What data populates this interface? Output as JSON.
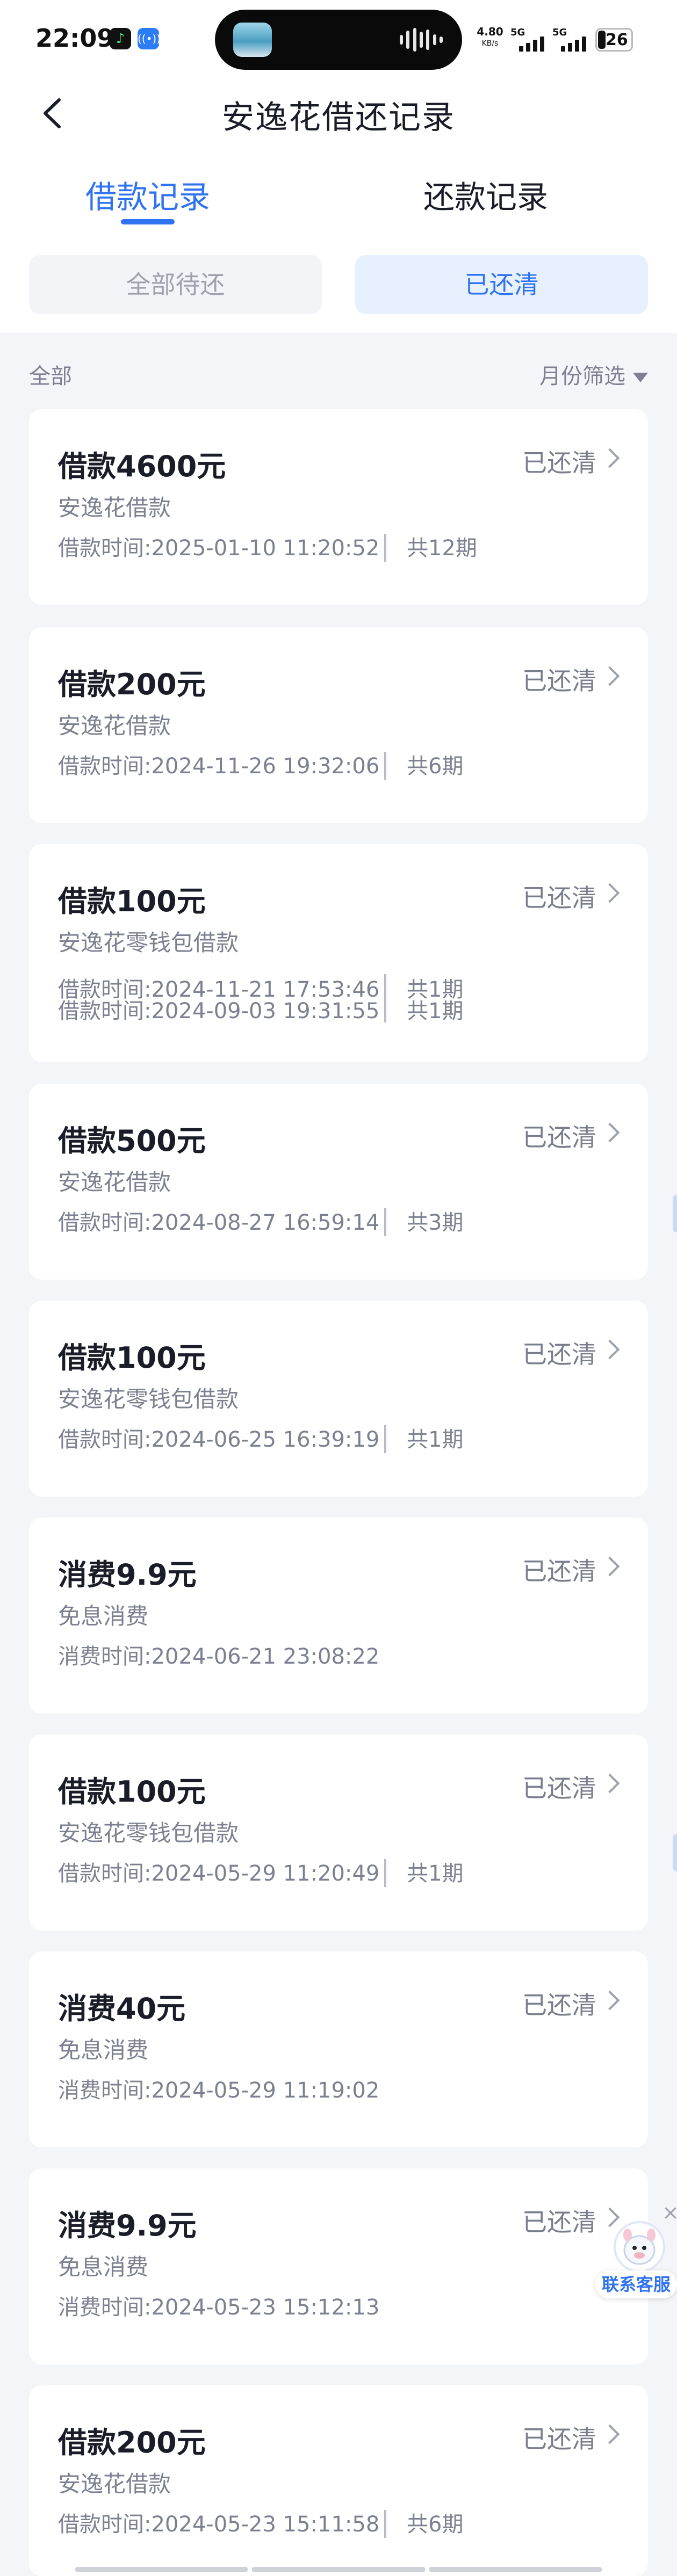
{
  "status_bar": {
    "time": "22:09",
    "net_speed": "4.80",
    "net_unit": "KB/s",
    "sim1": "5G",
    "sim2": "5G",
    "battery": "26",
    "app_icons": [
      "music-app-icon",
      "nfc-app-icon"
    ]
  },
  "header": {
    "title": "安逸花借还记录",
    "back_icon": "chevron-left-icon"
  },
  "tabs": [
    {
      "label": "借款记录",
      "active": true
    },
    {
      "label": "还款记录",
      "active": false
    }
  ],
  "filters": [
    {
      "label": "全部待还",
      "selected": false
    },
    {
      "label": "已还清",
      "selected": true
    }
  ],
  "list_header": {
    "left": "全部",
    "right": "月份筛选"
  },
  "records": [
    {
      "title": "借款4600元",
      "status": "已还清",
      "subtitle": "安逸花借款",
      "times": [
        "借款时间:2025-01-10 11:20:52"
      ],
      "periods": [
        "共12期"
      ]
    },
    {
      "title": "借款200元",
      "status": "已还清",
      "subtitle": "安逸花借款",
      "times": [
        "借款时间:2024-11-26 19:32:06"
      ],
      "periods": [
        "共6期"
      ]
    },
    {
      "title": "借款100元",
      "status": "已还清",
      "subtitle": "安逸花零钱包借款",
      "times": [
        "借款时间:2024-11-21 17:53:46",
        "借款时间:2024-09-03 19:31:55"
      ],
      "periods": [
        "共1期",
        "共1期"
      ]
    },
    {
      "title": "借款500元",
      "status": "已还清",
      "subtitle": "安逸花借款",
      "times": [
        "借款时间:2024-08-27 16:59:14"
      ],
      "periods": [
        "共3期"
      ]
    },
    {
      "title": "借款100元",
      "status": "已还清",
      "subtitle": "安逸花零钱包借款",
      "times": [
        "借款时间:2024-06-25 16:39:19"
      ],
      "periods": [
        "共1期"
      ]
    },
    {
      "title": "消费9.9元",
      "status": "已还清",
      "subtitle": "免息消费",
      "times": [
        "消费时间:2024-06-21 23:08:22"
      ],
      "periods": []
    },
    {
      "title": "借款100元",
      "status": "已还清",
      "subtitle": "安逸花零钱包借款",
      "times": [
        "借款时间:2024-05-29 11:20:49"
      ],
      "periods": [
        "共1期"
      ]
    },
    {
      "title": "消费40元",
      "status": "已还清",
      "subtitle": "免息消费",
      "times": [
        "消费时间:2024-05-29 11:19:02"
      ],
      "periods": []
    },
    {
      "title": "消费9.9元",
      "status": "已还清",
      "subtitle": "免息消费",
      "times": [
        "消费时间:2024-05-23 15:12:13"
      ],
      "periods": []
    },
    {
      "title": "借款200元",
      "status": "已还清",
      "subtitle": "安逸花借款",
      "times": [
        "借款时间:2024-05-23 15:11:58"
      ],
      "periods": [
        "共6期"
      ]
    }
  ],
  "service": {
    "label": "联系客服",
    "close": "×"
  },
  "colors": {
    "accent": "#2f72f2",
    "background": "#f4f5f8",
    "muted_text": "#7c8090",
    "selected_segment_bg": "#e7f0ff"
  }
}
